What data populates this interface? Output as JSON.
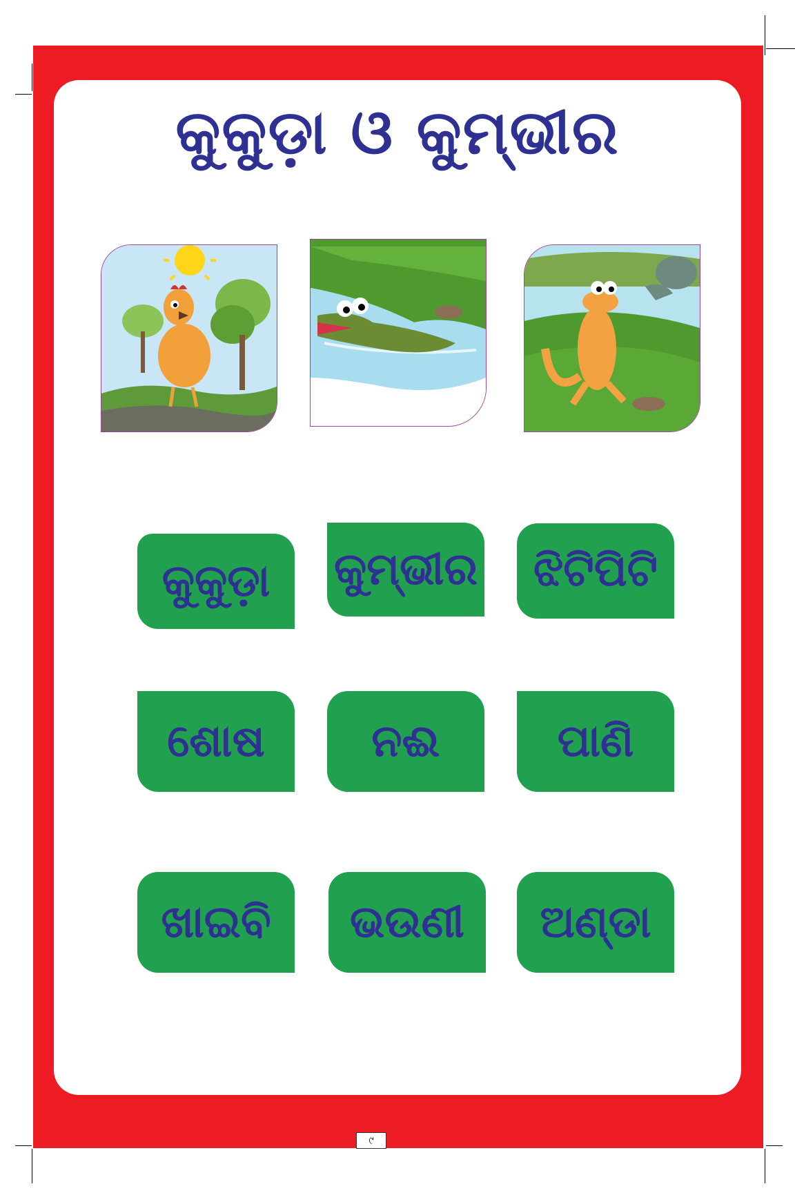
{
  "title": "କୁକୁଡ଼ା ଓ କୁମ୍ଭୀର",
  "illustrations": [
    {
      "icon": "hen-under-sun-icon"
    },
    {
      "icon": "crocodile-in-river-icon"
    },
    {
      "icon": "lizard-on-grass-icon"
    }
  ],
  "words": [
    "କୁକୁଡ଼ା",
    "କୁମ୍ଭୀର",
    "ଝିଟିପିଟି",
    "ଶୋଷ",
    "ନଈ",
    "ପାଣି",
    "ଖାଇବି",
    "ଭଉଣୀ",
    "ଅଣ୍ଡା"
  ],
  "page_number": "୯",
  "colors": {
    "frame": "#ed1c24",
    "card": "#21a04f",
    "text": "#2e3192"
  }
}
